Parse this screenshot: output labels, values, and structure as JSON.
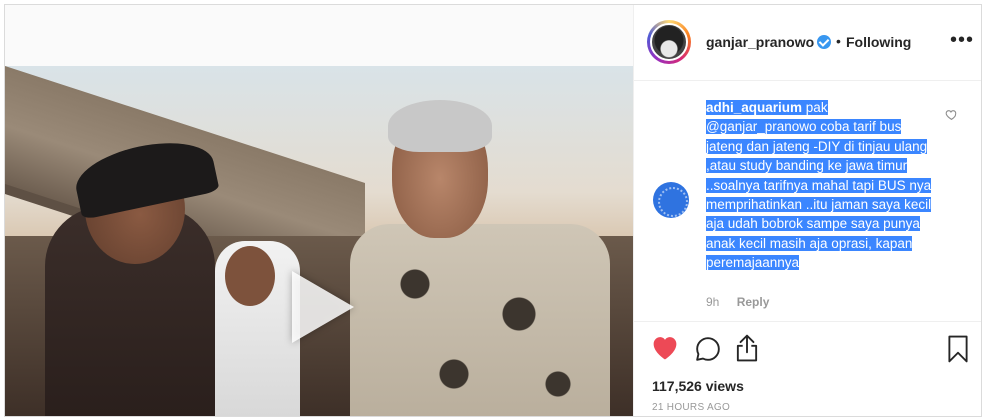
{
  "post": {
    "author": {
      "username": "ganjar_pranowo",
      "verified": true,
      "follow_status": "Following",
      "separator": "•"
    },
    "more_icon": "more-horizontal-icon",
    "media": {
      "type": "video",
      "play_icon": "play-icon"
    },
    "comment": {
      "username": "adhi_aquarium",
      "text": "pak @ganjar_pranowo coba tarif bus jateng dan jateng -DIY di tinjau ulang ,atau study banding ke jawa timur ..soalnya tarifnya mahal tapi BUS nya memprihatinkan ..itu jaman saya kecil aja udah bobrok sampe saya punya anak kecil masih aja oprasi, kapan peremajaannya",
      "time": "9h",
      "reply_label": "Reply",
      "like_icon": "heart-outline-icon"
    },
    "actions": {
      "like_icon": "heart-filled-icon",
      "comment_icon": "comment-icon",
      "share_icon": "share-icon",
      "save_icon": "bookmark-icon",
      "like_color": "#ed4956"
    },
    "views": "117,526 views",
    "timestamp": "21 HOURS AGO"
  },
  "colors": {
    "selection_highlight": "#3b86ff",
    "verified": "#3897f0",
    "muted_text": "#999999",
    "border": "#dbdbdb"
  }
}
